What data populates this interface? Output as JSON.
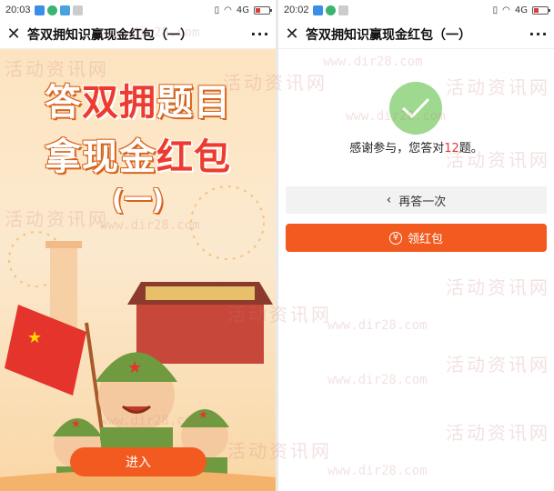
{
  "left": {
    "status": {
      "time": "20:03",
      "network": "4G"
    },
    "title": "答双拥知识赢现金红包（一）",
    "more": "···",
    "poster": {
      "line1a": "答",
      "line1b": "双拥",
      "line1c": "题目",
      "line2a": "拿现金",
      "line2b": "红包",
      "line3": "(一)"
    },
    "enter_button": "进入"
  },
  "right": {
    "status": {
      "time": "20:02",
      "network": "4G"
    },
    "title": "答双拥知识赢现金红包（一）",
    "more": "···",
    "result_prefix": "感谢参与，您答对",
    "result_score": "12",
    "result_suffix": "题。",
    "retry_button": "再答一次",
    "redpack_button": "领红包"
  },
  "watermark": {
    "cn": "活动资讯网",
    "url": "www.dir28.com"
  },
  "colors": {
    "accent": "#f25a1f",
    "success": "#9ed98f",
    "score": "#e0393a"
  }
}
